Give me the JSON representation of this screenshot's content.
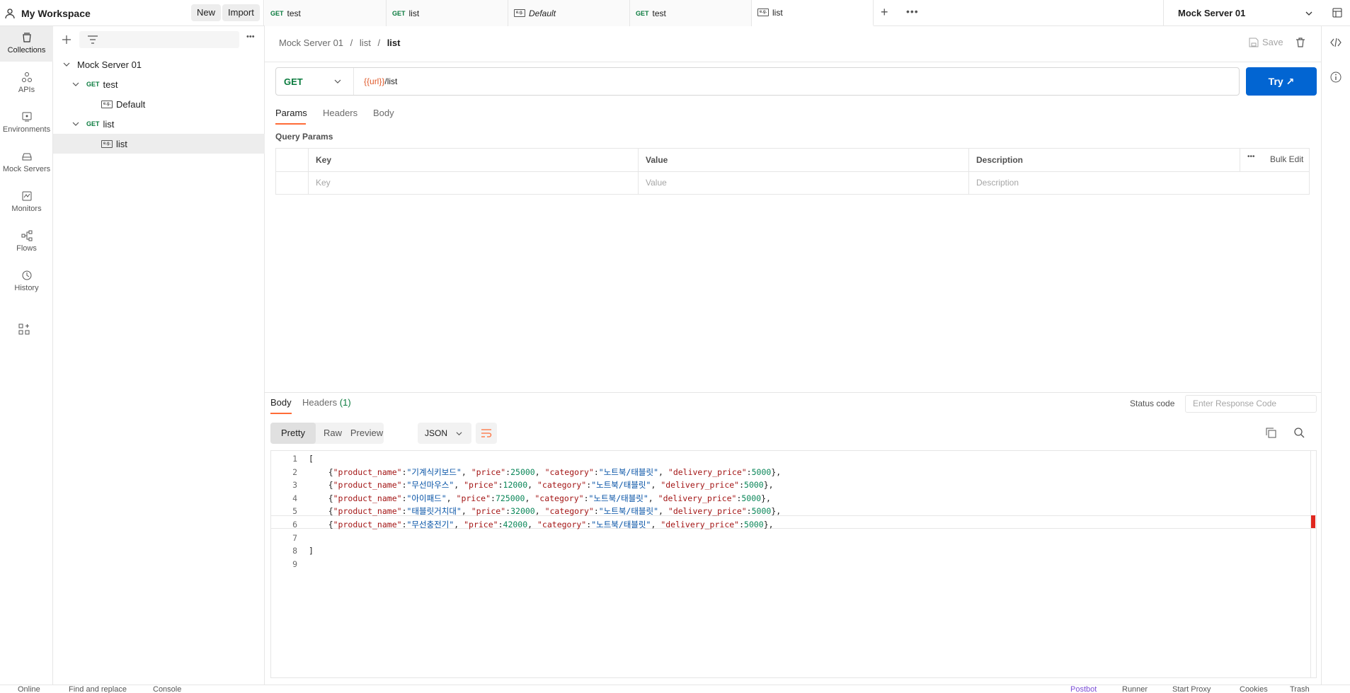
{
  "workspace": {
    "name": "My Workspace",
    "new_label": "New",
    "import_label": "Import"
  },
  "tabs": [
    {
      "method": "GET",
      "label": "test",
      "kind": "request"
    },
    {
      "method": "GET",
      "label": "list",
      "kind": "request"
    },
    {
      "method": "",
      "label": "Default",
      "kind": "example"
    },
    {
      "method": "GET",
      "label": "test",
      "kind": "request"
    },
    {
      "method": "",
      "label": "list",
      "kind": "example"
    }
  ],
  "environment": {
    "selected": "Mock Server 01"
  },
  "nav": [
    "Collections",
    "APIs",
    "Environments",
    "Mock Servers",
    "Monitors",
    "Flows",
    "History"
  ],
  "sidebar": {
    "collection": "Mock Server 01",
    "items": [
      {
        "method": "GET",
        "label": "test"
      },
      {
        "label": "Default"
      },
      {
        "method": "GET",
        "label": "list"
      },
      {
        "label": "list"
      }
    ]
  },
  "breadcrumb": {
    "part1": "Mock Server 01",
    "sep": "/",
    "part2": "list",
    "current": "list",
    "save_label": "Save"
  },
  "request": {
    "method": "GET",
    "url_var": "{{url}}",
    "url_path": "/list",
    "try_label": "Try ↗"
  },
  "req_tabs": [
    "Params",
    "Headers",
    "Body"
  ],
  "query": {
    "title": "Query Params",
    "headers": [
      "Key",
      "Value",
      "Description"
    ],
    "bulk_edit": "Bulk Edit",
    "placeholders": [
      "Key",
      "Value",
      "Description"
    ]
  },
  "response": {
    "tabs": {
      "body": "Body",
      "headers": "Headers",
      "headers_count": "(1)"
    },
    "status_label": "Status code",
    "status_placeholder": "Enter Response Code",
    "views": [
      "Pretty",
      "Raw",
      "Preview"
    ],
    "format": "JSON"
  },
  "code_lines": [
    {
      "n": "1",
      "tokens": [
        [
          "pun",
          "["
        ]
      ]
    },
    {
      "n": "2",
      "tokens": [
        [
          "pun",
          "    {"
        ],
        [
          "key",
          "\"product_name\""
        ],
        [
          "pun",
          ":"
        ],
        [
          "str",
          "\"기계식키보드\""
        ],
        [
          "pun",
          ", "
        ],
        [
          "key",
          "\"price\""
        ],
        [
          "pun",
          ":"
        ],
        [
          "num",
          "25000"
        ],
        [
          "pun",
          ", "
        ],
        [
          "key",
          "\"category\""
        ],
        [
          "pun",
          ":"
        ],
        [
          "str",
          "\"노트북/태블릿\""
        ],
        [
          "pun",
          ", "
        ],
        [
          "key",
          "\"delivery_price\""
        ],
        [
          "pun",
          ":"
        ],
        [
          "num",
          "5000"
        ],
        [
          "pun",
          "},"
        ]
      ]
    },
    {
      "n": "3",
      "tokens": [
        [
          "pun",
          "    {"
        ],
        [
          "key",
          "\"product_name\""
        ],
        [
          "pun",
          ":"
        ],
        [
          "str",
          "\"무선마우스\""
        ],
        [
          "pun",
          ", "
        ],
        [
          "key",
          "\"price\""
        ],
        [
          "pun",
          ":"
        ],
        [
          "num",
          "12000"
        ],
        [
          "pun",
          ", "
        ],
        [
          "key",
          "\"category\""
        ],
        [
          "pun",
          ":"
        ],
        [
          "str",
          "\"노트북/태블릿\""
        ],
        [
          "pun",
          ", "
        ],
        [
          "key",
          "\"delivery_price\""
        ],
        [
          "pun",
          ":"
        ],
        [
          "num",
          "5000"
        ],
        [
          "pun",
          "},"
        ]
      ]
    },
    {
      "n": "4",
      "tokens": [
        [
          "pun",
          "    {"
        ],
        [
          "key",
          "\"product_name\""
        ],
        [
          "pun",
          ":"
        ],
        [
          "str",
          "\"아이패드\""
        ],
        [
          "pun",
          ", "
        ],
        [
          "key",
          "\"price\""
        ],
        [
          "pun",
          ":"
        ],
        [
          "num",
          "725000"
        ],
        [
          "pun",
          ", "
        ],
        [
          "key",
          "\"category\""
        ],
        [
          "pun",
          ":"
        ],
        [
          "str",
          "\"노트북/태블릿\""
        ],
        [
          "pun",
          ", "
        ],
        [
          "key",
          "\"delivery_price\""
        ],
        [
          "pun",
          ":"
        ],
        [
          "num",
          "5000"
        ],
        [
          "pun",
          "},"
        ]
      ]
    },
    {
      "n": "5",
      "tokens": [
        [
          "pun",
          "    {"
        ],
        [
          "key",
          "\"product_name\""
        ],
        [
          "pun",
          ":"
        ],
        [
          "str",
          "\"태블릿거치대\""
        ],
        [
          "pun",
          ", "
        ],
        [
          "key",
          "\"price\""
        ],
        [
          "pun",
          ":"
        ],
        [
          "num",
          "32000"
        ],
        [
          "pun",
          ", "
        ],
        [
          "key",
          "\"category\""
        ],
        [
          "pun",
          ":"
        ],
        [
          "str",
          "\"노트북/태블릿\""
        ],
        [
          "pun",
          ", "
        ],
        [
          "key",
          "\"delivery_price\""
        ],
        [
          "pun",
          ":"
        ],
        [
          "num",
          "5000"
        ],
        [
          "pun",
          "},"
        ]
      ]
    },
    {
      "n": "6",
      "tokens": [
        [
          "pun",
          "    {"
        ],
        [
          "key",
          "\"product_name\""
        ],
        [
          "pun",
          ":"
        ],
        [
          "str",
          "\"무선충전기\""
        ],
        [
          "pun",
          ", "
        ],
        [
          "key",
          "\"price\""
        ],
        [
          "pun",
          ":"
        ],
        [
          "num",
          "42000"
        ],
        [
          "pun",
          ", "
        ],
        [
          "key",
          "\"category\""
        ],
        [
          "pun",
          ":"
        ],
        [
          "str",
          "\"노트북/태블릿\""
        ],
        [
          "pun",
          ", "
        ],
        [
          "key",
          "\"delivery_price\""
        ],
        [
          "pun",
          ":"
        ],
        [
          "num",
          "5000"
        ],
        [
          "pun",
          "},"
        ]
      ]
    },
    {
      "n": "7",
      "tokens": []
    },
    {
      "n": "8",
      "tokens": [
        [
          "pun",
          "]"
        ]
      ]
    },
    {
      "n": "9",
      "tokens": []
    }
  ],
  "statusbar": [
    "Online",
    "Find and replace",
    "Console",
    "Postbot",
    "Runner",
    "Start Proxy",
    "Cookies",
    "Trash"
  ],
  "colors": {
    "accent": "#ff6c37",
    "primary": "#0265d2",
    "get": "#0a7b3e",
    "var": "#e05a2b"
  }
}
